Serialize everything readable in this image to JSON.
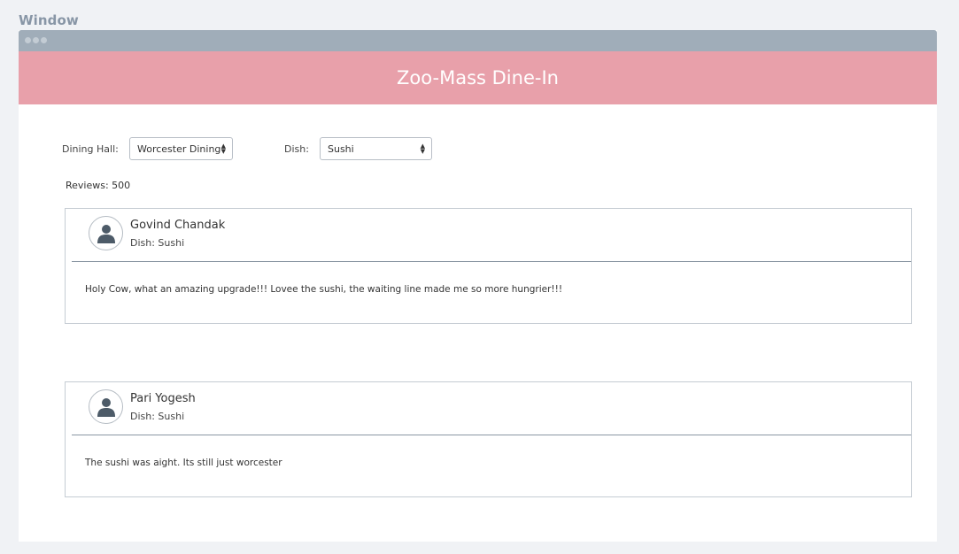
{
  "window": {
    "label": "Window"
  },
  "app": {
    "title": "Zoo-Mass Dine-In"
  },
  "filters": {
    "dining_hall_label": "Dining Hall:",
    "dining_hall_value": "Worcester Dining",
    "dish_label": "Dish:",
    "dish_value": "Sushi"
  },
  "reviews": {
    "count_text": "Reviews: 500",
    "items": [
      {
        "name": "Govind Chandak",
        "dish": "Dish: Sushi",
        "text": "Holy Cow, what an amazing upgrade!!! Lovee the sushi, the waiting line made me so more hungrier!!!"
      },
      {
        "name": "Pari Yogesh",
        "dish": "Dish: Sushi",
        "text": "The sushi was aight. Its still just worcester"
      }
    ]
  },
  "icons": {
    "avatar": "user-icon",
    "select_arrows": "updown-chevron-icon"
  },
  "colors": {
    "header": "#e8a0aa",
    "titlebar": "#a0adb9",
    "background": "#f0f2f5"
  }
}
